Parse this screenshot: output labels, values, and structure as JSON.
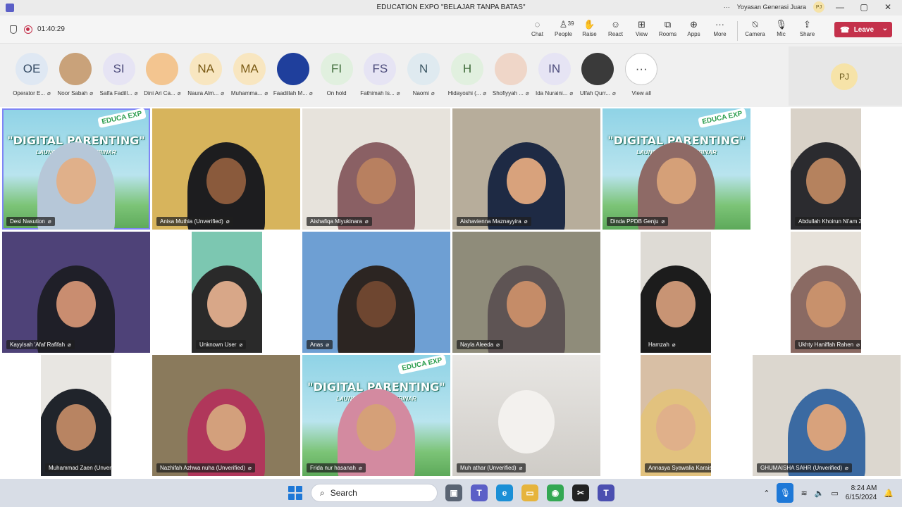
{
  "window": {
    "title": "EDUCATION EXPO \"BELAJAR TANPA BATAS\"",
    "org": "Yoyasan Generasi Juara",
    "user_initials": "PJ",
    "more": "···",
    "minimize": "—",
    "maximize": "▢",
    "close": "✕"
  },
  "meeting": {
    "timer": "01:40:29",
    "people_count": "39",
    "tools": [
      {
        "label": "Chat",
        "icon": "chat-icon",
        "glyph": "◌"
      },
      {
        "label": "People",
        "icon": "people-icon",
        "glyph": "♙"
      },
      {
        "label": "Raise",
        "icon": "raise-hand-icon",
        "glyph": "✋"
      },
      {
        "label": "React",
        "icon": "react-icon",
        "glyph": "☺"
      },
      {
        "label": "View",
        "icon": "view-icon",
        "glyph": "⊞"
      },
      {
        "label": "Rooms",
        "icon": "rooms-icon",
        "glyph": "⧉"
      },
      {
        "label": "Apps",
        "icon": "apps-icon",
        "glyph": "⊕"
      },
      {
        "label": "More",
        "icon": "more-icon",
        "glyph": "···"
      }
    ],
    "media": [
      {
        "label": "Camera",
        "icon": "camera-off-icon",
        "glyph": "⍉"
      },
      {
        "label": "Mic",
        "icon": "mic-off-icon",
        "glyph": "🎙"
      },
      {
        "label": "Share",
        "icon": "share-icon",
        "glyph": "⇪"
      }
    ],
    "leave_label": "Leave"
  },
  "strip": {
    "participants": [
      {
        "initials": "OE",
        "name": "Operator E...",
        "color": "#dfe8f3",
        "text": "#344a63"
      },
      {
        "initials": "",
        "name": "Noor Sabah",
        "color": "#c9a27a",
        "text": "#333"
      },
      {
        "initials": "SI",
        "name": "Salfa Fadill...",
        "color": "#e6e4f4",
        "text": "#4b4a7a"
      },
      {
        "initials": "",
        "name": "Dini Ari Ca...",
        "color": "#f3c590",
        "text": "#333"
      },
      {
        "initials": "NA",
        "name": "Naura Alm...",
        "color": "#f8e6c0",
        "text": "#7a5a14"
      },
      {
        "initials": "MA",
        "name": "Muhamma...",
        "color": "#f8e6c0",
        "text": "#7a5a14"
      },
      {
        "initials": "",
        "name": "Faadillah M...",
        "color": "#1f3f9c",
        "text": "#fff"
      },
      {
        "initials": "FI",
        "name": "On hold",
        "color": "#e1f0df",
        "text": "#3f6b3a"
      },
      {
        "initials": "FS",
        "name": "Fathimah Is...",
        "color": "#e6e4f4",
        "text": "#4b4a7a"
      },
      {
        "initials": "N",
        "name": "Naomi",
        "color": "#dfeaf0",
        "text": "#3e5966"
      },
      {
        "initials": "H",
        "name": "Hidayoshi (...",
        "color": "#e1f0df",
        "text": "#3f6b3a"
      },
      {
        "initials": "",
        "name": "Shofiyyah ...",
        "color": "#efd6c8",
        "text": "#333"
      },
      {
        "initials": "IN",
        "name": "Ida Nuraini...",
        "color": "#e6e4f4",
        "text": "#4b4a7a"
      },
      {
        "initials": "",
        "name": "Ulfah Qurr...",
        "color": "#3a3a3a",
        "text": "#fff"
      }
    ],
    "view_all": "View all",
    "self_initials": "PJ"
  },
  "grid": {
    "banner_title": "\"DIGITAL PARENTING\"",
    "banner_sub": "LAUNCHING SQUA        WEBINAR",
    "banner_badge": "EDUCA EXP",
    "tiles": [
      {
        "name": "Desi Nasution",
        "bg": "#7fc9b0",
        "face": "#e0b08a",
        "hijab": "#b6c7d8",
        "banner": true,
        "active": true
      },
      {
        "name": "Anisa Muthia (Unverified)",
        "bg": "#d7b45c",
        "face": "#8a5a3c",
        "hijab": "#1d1d1f"
      },
      {
        "name": "Aishafiqa Miyukinara",
        "bg": "#e7e3dc",
        "face": "#b88060",
        "hijab": "#8a6064"
      },
      {
        "name": "Aishavienna Maznayyira",
        "bg": "#b7ad9b",
        "face": "#d8a27c",
        "hijab": "#1e2a44"
      },
      {
        "name": "Dinda PPDB Genju",
        "bg": "#7fc9b0",
        "face": "#d5a078",
        "hijab": "#8e6a66",
        "banner": true
      },
      {
        "name": "Abdullah Khoirun Ni'am Zamzami",
        "bg": "#d9d2c8",
        "face": "#b5825e",
        "hijab": "#2b2b2f"
      },
      {
        "name": "Kayyisah 'Afaf Rafifah",
        "bg": "#4e4278",
        "face": "#c98d70",
        "hijab": "#1f1f28"
      },
      {
        "name": "Unknown User",
        "bg": "#7cc7b1",
        "face": "#d8a788",
        "hijab": "#2a2a2a"
      },
      {
        "name": "Anas",
        "bg": "#6e9fd3",
        "face": "#6e4630",
        "hijab": "#2c2522"
      },
      {
        "name": "Nayla Aleeda",
        "bg": "#8f8c7a",
        "face": "#c58c68",
        "hijab": "#5e5454"
      },
      {
        "name": "Hamzah",
        "bg": "#dedbd5",
        "face": "#c89474",
        "hijab": "#1c1c1c"
      },
      {
        "name": "Ukhty Haniffah Rahen",
        "bg": "#e7e2da",
        "face": "#c8916c",
        "hijab": "#8a6a63"
      },
      {
        "name": "Muhammad Zaen (Unverified)",
        "bg": "#e8e6e2",
        "face": "#b88462",
        "hijab": "#20242b"
      },
      {
        "name": "Nazhifah Azhwa nuha (Unverified)",
        "bg": "#8a7a5c",
        "face": "#d3a07c",
        "hijab": "#b0375b"
      },
      {
        "name": "Frida nur hasanah",
        "bg": "#7fc9b0",
        "face": "#d5a078",
        "hijab": "#d38aa0",
        "banner": true
      },
      {
        "name": "Muh athar (Unverified)",
        "bg": "#d8d6d2",
        "face": "",
        "hijab": ""
      },
      {
        "name": "Annasya Syawalia Karaissamajiid",
        "bg": "#d8bfa5",
        "face": "#e0b08a",
        "hijab": "#e2c27e"
      },
      {
        "name": "GHUMAISHA SAHR (Unverified)",
        "bg": "#dcd7cf",
        "face": "#d8a27c",
        "hijab": "#3b6aa2"
      }
    ]
  },
  "taskbar": {
    "search_placeholder": "Search",
    "time": "8:24 AM",
    "date": "6/15/2024"
  },
  "colors": {
    "accent": "#5b5fc7",
    "leave": "#c4314b",
    "active_outline": "#7f85f5"
  }
}
